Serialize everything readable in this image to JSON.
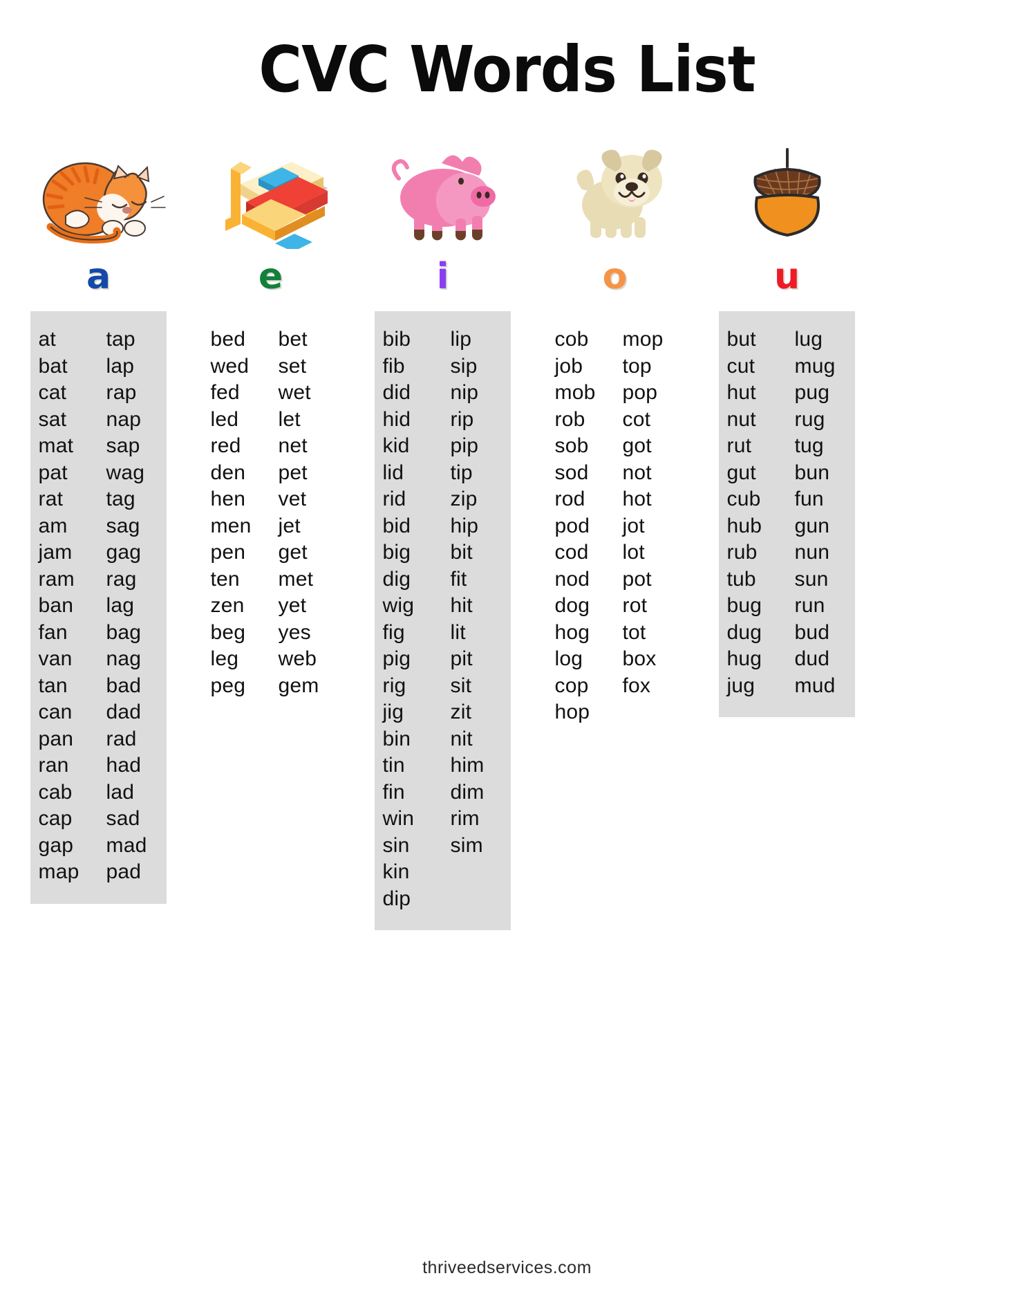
{
  "title": "CVC Words List",
  "footer": "thriveedservices.com",
  "columns": [
    {
      "vowel": "a",
      "vowel_color": "#1449a8",
      "image_name": "cat-illustration",
      "shaded": true,
      "left": [
        "at",
        "bat",
        "cat",
        "sat",
        "mat",
        "pat",
        "rat",
        "am",
        "jam",
        "ram",
        "ban",
        "fan",
        "van",
        "tan",
        "can",
        "pan",
        "ran",
        "cab",
        "cap",
        "gap",
        "map"
      ],
      "right": [
        "tap",
        "lap",
        "rap",
        "nap",
        "sap",
        "wag",
        "tag",
        "sag",
        "gag",
        "rag",
        "lag",
        "bag",
        "nag",
        "bad",
        "dad",
        "rad",
        "had",
        "lad",
        "sad",
        "mad",
        "pad"
      ]
    },
    {
      "vowel": "e",
      "vowel_color": "#12803a",
      "image_name": "bed-illustration",
      "shaded": false,
      "left": [
        "bed",
        "wed",
        "fed",
        "led",
        "red",
        "den",
        "hen",
        "men",
        "pen",
        "ten",
        "zen",
        "beg",
        "leg",
        "peg"
      ],
      "right": [
        "bet",
        "set",
        "wet",
        "let",
        "net",
        "pet",
        "vet",
        "jet",
        "get",
        "met",
        "yet",
        "yes",
        "web",
        "gem"
      ]
    },
    {
      "vowel": "i",
      "vowel_color": "#8b3ef0",
      "image_name": "pig-illustration",
      "shaded": true,
      "left": [
        "bib",
        "fib",
        "did",
        "hid",
        "kid",
        "lid",
        "rid",
        "bid",
        "big",
        "dig",
        "wig",
        "fig",
        "pig",
        "rig",
        "jig",
        "bin",
        "tin",
        "fin",
        "win",
        "sin",
        "kin",
        "dip"
      ],
      "right": [
        "lip",
        "sip",
        "nip",
        "rip",
        "pip",
        "tip",
        "zip",
        "hip",
        "bit",
        "fit",
        "hit",
        "lit",
        "pit",
        "sit",
        "zit",
        "nit",
        "him",
        "dim",
        "rim",
        "sim"
      ]
    },
    {
      "vowel": "o",
      "vowel_color": "#f59447",
      "image_name": "dog-illustration",
      "shaded": false,
      "left": [
        "cob",
        "job",
        "mob",
        "rob",
        "sob",
        "sod",
        "rod",
        "pod",
        "cod",
        "nod",
        "dog",
        "hog",
        "log",
        "cop",
        "hop"
      ],
      "right": [
        "mop",
        "top",
        "pop",
        "cot",
        "got",
        "not",
        "hot",
        "jot",
        "lot",
        "pot",
        "rot",
        "tot",
        "box",
        "fox"
      ]
    },
    {
      "vowel": "u",
      "vowel_color": "#ed1c24",
      "image_name": "acorn-illustration",
      "shaded": true,
      "left": [
        "but",
        "cut",
        "hut",
        "nut",
        "rut",
        "gut",
        "cub",
        "hub",
        "rub",
        "tub",
        "bug",
        "dug",
        "hug",
        "jug"
      ],
      "right": [
        "lug",
        "mug",
        "pug",
        "rug",
        "tug",
        "bun",
        "fun",
        "gun",
        "nun",
        "sun",
        "run",
        "bud",
        "dud",
        "mud"
      ]
    }
  ]
}
